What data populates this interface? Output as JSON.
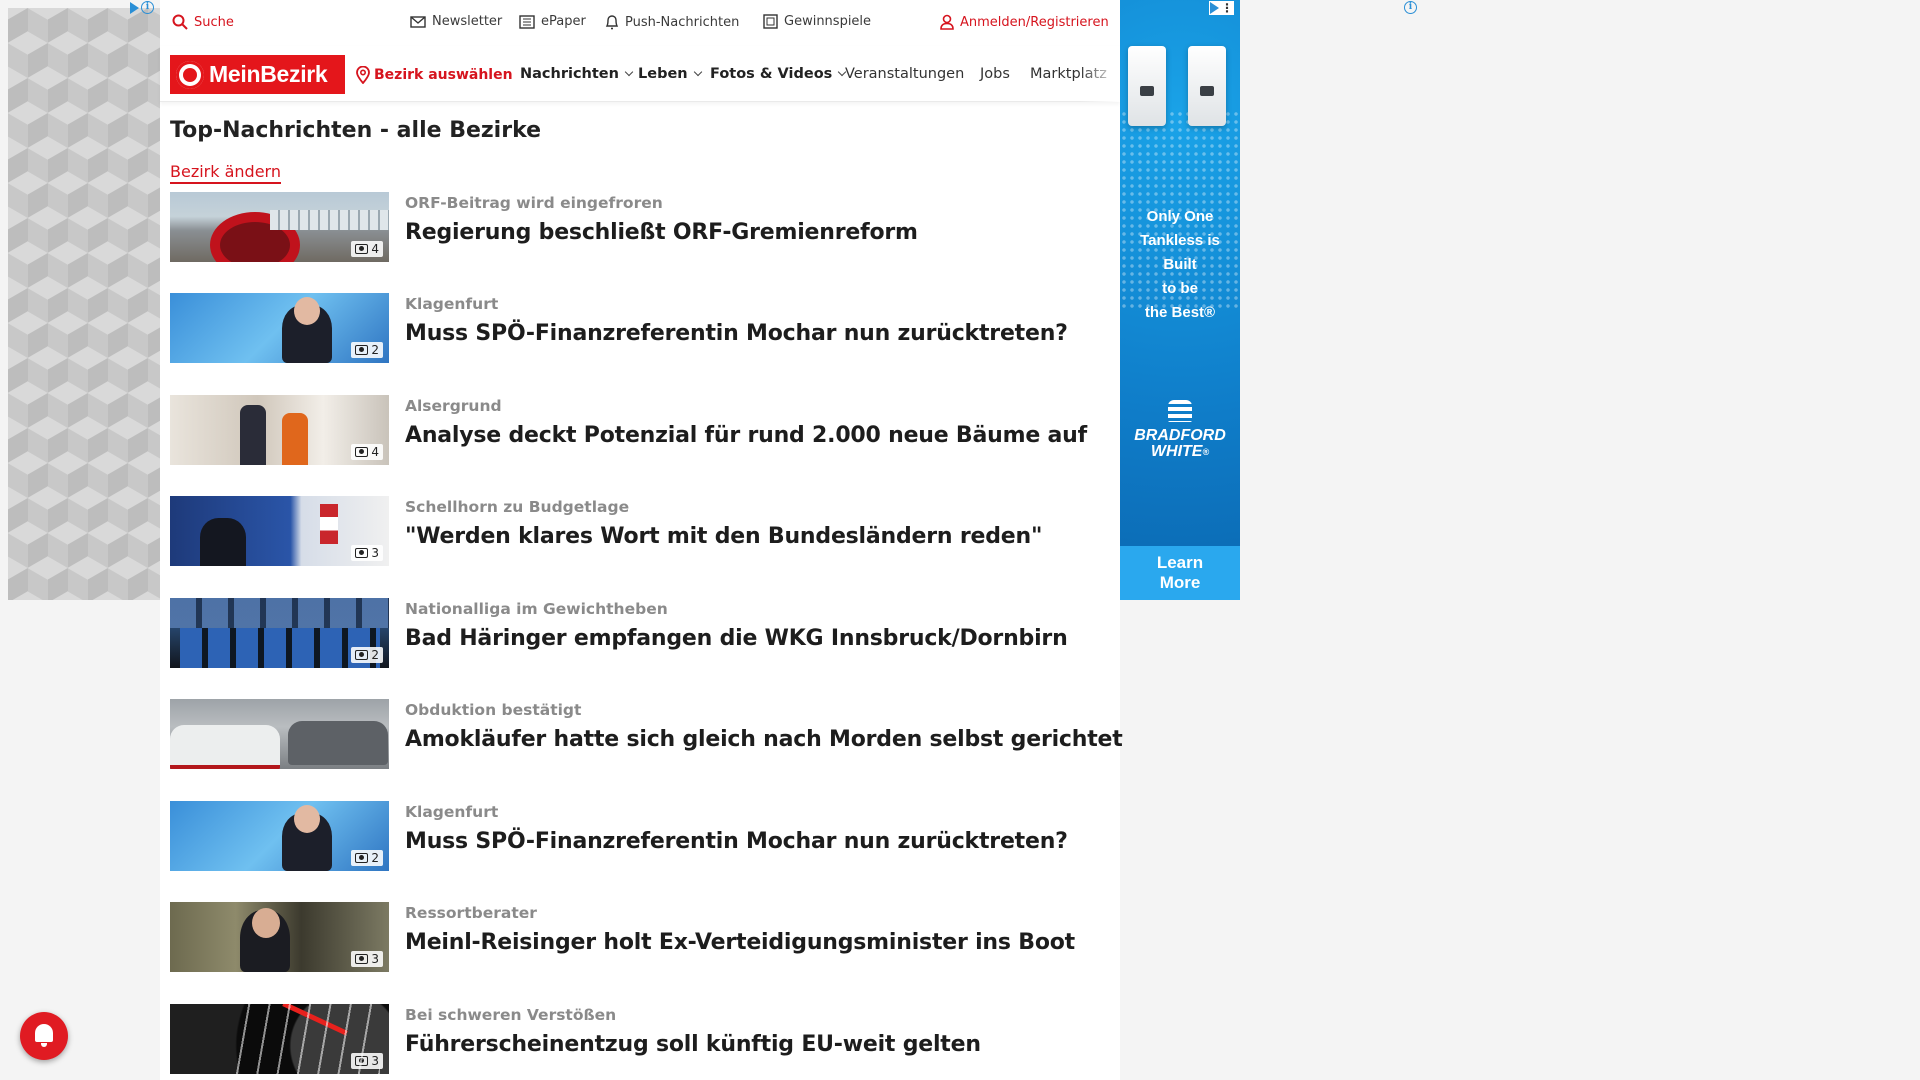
{
  "utility": {
    "search": "Suche",
    "newsletter": "Newsletter",
    "epaper": "ePaper",
    "push": "Push-Nachrichten",
    "contests": "Gewinnspiele",
    "login": "Anmelden/Registrieren"
  },
  "nav": {
    "logo": "MeinBezirk",
    "select_district": "Bezirk auswählen",
    "items": [
      "Nachrichten",
      "Leben",
      "Fotos & Videos",
      "Veranstaltungen",
      "Jobs",
      "Marktplatz"
    ]
  },
  "page": {
    "title": "Top-Nachrichten - alle Bezirke",
    "change_district": "Bezirk ändern"
  },
  "articles": [
    {
      "kicker": "ORF-Beitrag wird eingefroren",
      "headline": "Regierung beschließt ORF-Gremienreform",
      "images": "4"
    },
    {
      "kicker": "Klagenfurt",
      "headline": "Muss SPÖ-Finanzreferentin Mochar nun zurücktreten?",
      "images": "2"
    },
    {
      "kicker": "Alsergrund",
      "headline": "Analyse deckt Potenzial für rund 2.000 neue Bäume auf",
      "images": "4"
    },
    {
      "kicker": "Schellhorn zu Budgetlage",
      "headline": "\"Werden klares Wort mit den Bundesländern reden\"",
      "images": "3"
    },
    {
      "kicker": "Nationalliga im Gewichtheben",
      "headline": "Bad Häringer empfangen die WKG Innsbruck/Dornbirn",
      "images": "2"
    },
    {
      "kicker": "Obduktion bestätigt",
      "headline": "Amokläufer hatte sich gleich nach Morden selbst gerichtet",
      "images": ""
    },
    {
      "kicker": "Klagenfurt",
      "headline": "Muss SPÖ-Finanzreferentin Mochar nun zurücktreten?",
      "images": "2"
    },
    {
      "kicker": "Ressortberater",
      "headline": "Meinl-Reisinger holt Ex-Verteidigungsminister ins Boot",
      "images": "3"
    },
    {
      "kicker": "Bei schweren Verstößen",
      "headline": "Führerscheinentzug soll künftig EU-weit gelten",
      "images": "3"
    }
  ],
  "ad_right": {
    "text_lines": [
      "Only One",
      "Tankless is",
      "Built",
      "to be",
      "the Best®"
    ],
    "brand_lines": [
      "BRADFORD",
      "WHITE"
    ],
    "brand_mark": "®",
    "cta_lines": [
      "Learn",
      "More"
    ]
  },
  "colors": {
    "brand_red": "#e4161b",
    "ad_blue": "#0f7dc9"
  }
}
